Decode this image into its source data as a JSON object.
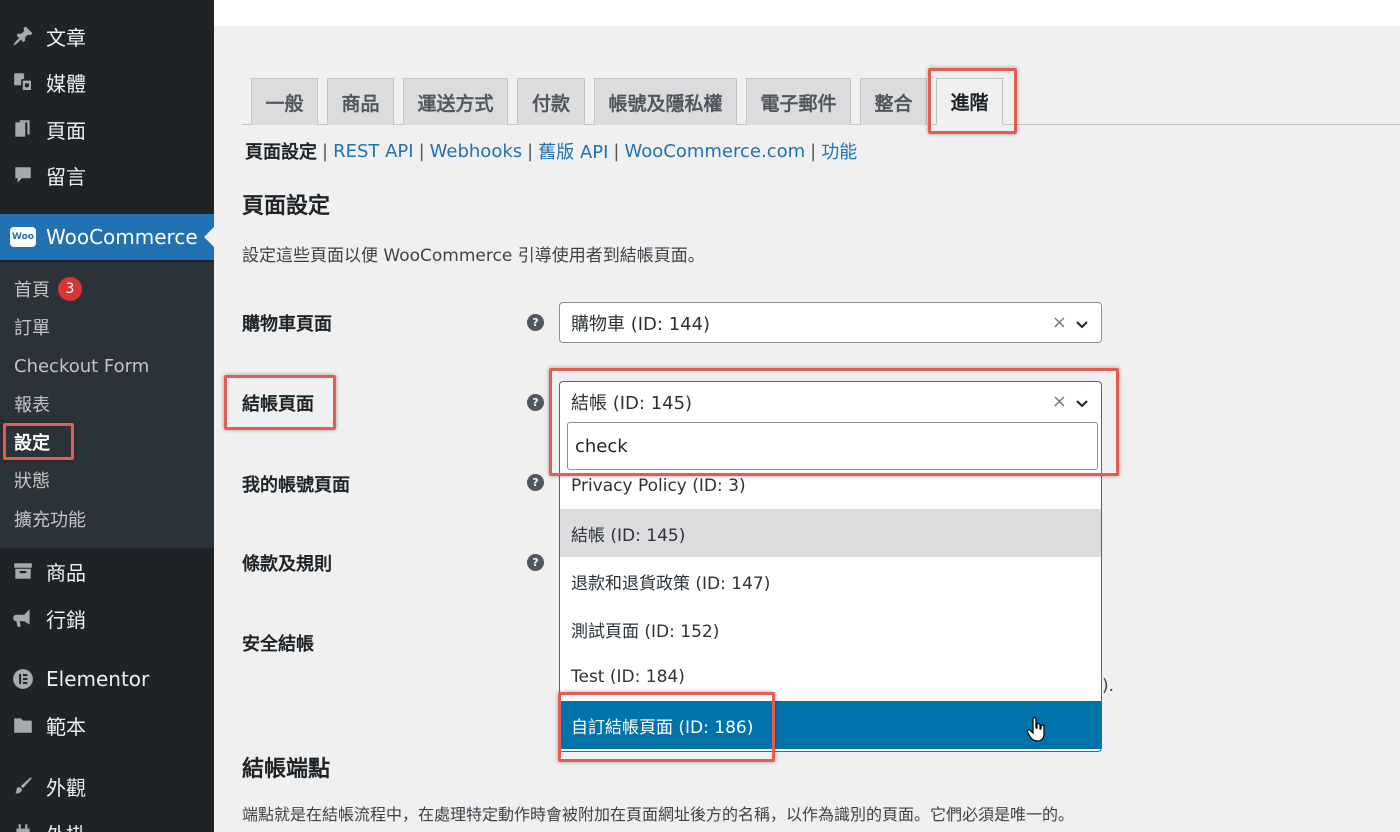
{
  "sidebar": {
    "top_items": [
      {
        "label": "文章",
        "icon": "pin-icon"
      },
      {
        "label": "媒體",
        "icon": "media-icon"
      },
      {
        "label": "頁面",
        "icon": "pages-icon"
      },
      {
        "label": "留言",
        "icon": "comments-icon"
      }
    ],
    "woocommerce": {
      "label": "WooCommerce",
      "logo": "Woo"
    },
    "submenu": [
      {
        "label": "首頁",
        "badge": "3"
      },
      {
        "label": "訂單"
      },
      {
        "label": "Checkout Form"
      },
      {
        "label": "報表"
      },
      {
        "label": "設定"
      },
      {
        "label": "狀態"
      },
      {
        "label": "擴充功能"
      }
    ],
    "bottom_items": [
      {
        "label": "商品",
        "icon": "archive-icon"
      },
      {
        "label": "行銷",
        "icon": "megaphone-icon"
      },
      {
        "label": "Elementor",
        "icon": "elementor-icon"
      },
      {
        "label": "範本",
        "icon": "folder-icon"
      },
      {
        "label": "外觀",
        "icon": "brush-icon"
      },
      {
        "label": "外掛",
        "icon": "plugin-icon"
      }
    ]
  },
  "tabs": [
    "一般",
    "商品",
    "運送方式",
    "付款",
    "帳號及隱私權",
    "電子郵件",
    "整合",
    "進階"
  ],
  "subnav": {
    "current": "頁面設定",
    "links": [
      "REST API",
      "Webhooks",
      "舊版 API",
      "WooCommerce.com",
      "功能"
    ]
  },
  "section": {
    "title": "頁面設定",
    "description": "設定這些頁面以便 WooCommerce 引導使用者到結帳頁面。"
  },
  "fields": {
    "cart": {
      "label": "購物車頁面",
      "value": "購物車 (ID: 144)"
    },
    "checkout": {
      "label": "結帳頁面",
      "value": "結帳 (ID: 145)"
    },
    "myaccount": {
      "label": "我的帳號頁面"
    },
    "terms": {
      "label": "條款及規則"
    },
    "secure": {
      "label": "安全結帳"
    }
  },
  "dropdown": {
    "search_value": "check",
    "options": [
      "Privacy Policy (ID: 3)",
      "結帳 (ID: 145)",
      "退款和退貨政策 (ID: 147)",
      "測試頁面 (ID: 152)",
      "Test (ID: 184)",
      "自訂結帳頁面 (ID: 186)"
    ]
  },
  "endpoints": {
    "title": "結帳端點",
    "description": "端點就是在結帳流程中，在處理特定動作時會被附加在頁面網址後方的名稱，以作為識別的頁面。它們必須是唯一的。"
  },
  "misc": {
    "clear_symbol": "×",
    "paren_fragment": ")."
  },
  "colors": {
    "sidebar": "#1d2327",
    "accent": "#2271b1",
    "highlight": "#e35d55",
    "selected_option": "#0073aa",
    "badge": "#d63638"
  }
}
